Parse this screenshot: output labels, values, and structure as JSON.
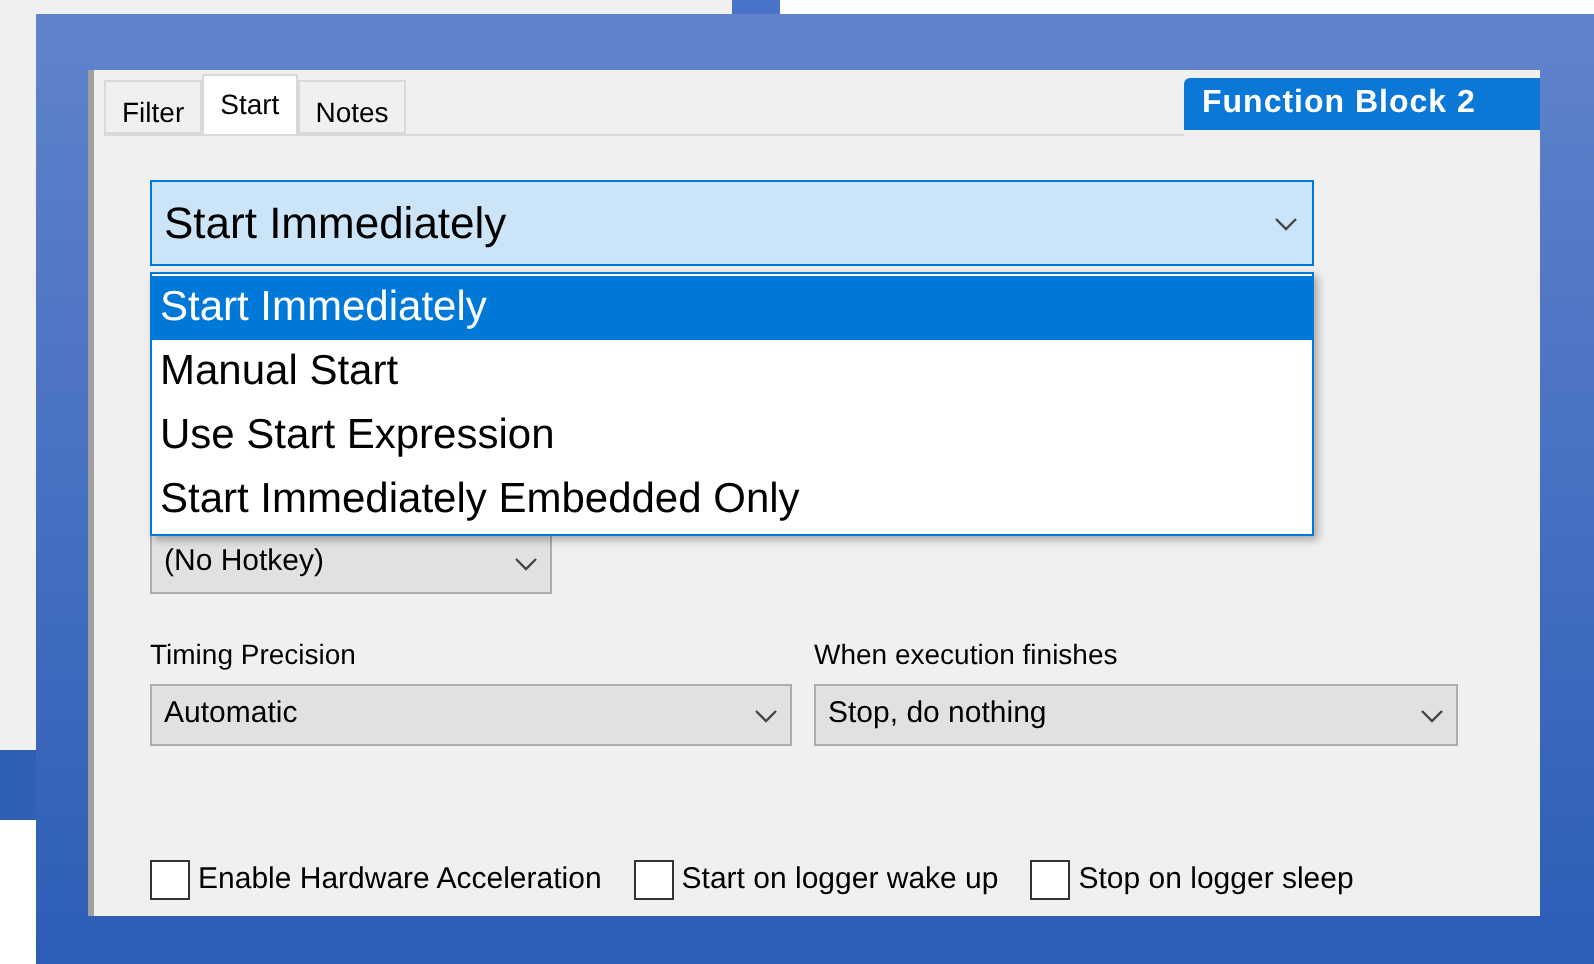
{
  "tabs": [
    {
      "label": "Filter",
      "selected": false
    },
    {
      "label": "Start",
      "selected": true
    },
    {
      "label": "Notes",
      "selected": false
    }
  ],
  "block_title": "Function Block 2",
  "start_mode": {
    "value": "Start Immediately",
    "expanded": true,
    "options": [
      {
        "label": "Start Immediately",
        "selected": true
      },
      {
        "label": "Manual Start",
        "selected": false
      },
      {
        "label": "Use Start Expression",
        "selected": false
      },
      {
        "label": "Start Immediately Embedded Only",
        "selected": false
      }
    ]
  },
  "hotkey": {
    "value": "(No Hotkey)"
  },
  "timing_precision": {
    "label": "Timing Precision",
    "value": "Automatic"
  },
  "when_finishes": {
    "label": "When execution finishes",
    "value": "Stop, do nothing"
  },
  "checkboxes": [
    {
      "label": "Enable Hardware Acceleration",
      "checked": false
    },
    {
      "label": "Start on logger wake up",
      "checked": false
    },
    {
      "label": "Stop on logger sleep",
      "checked": false
    }
  ]
}
